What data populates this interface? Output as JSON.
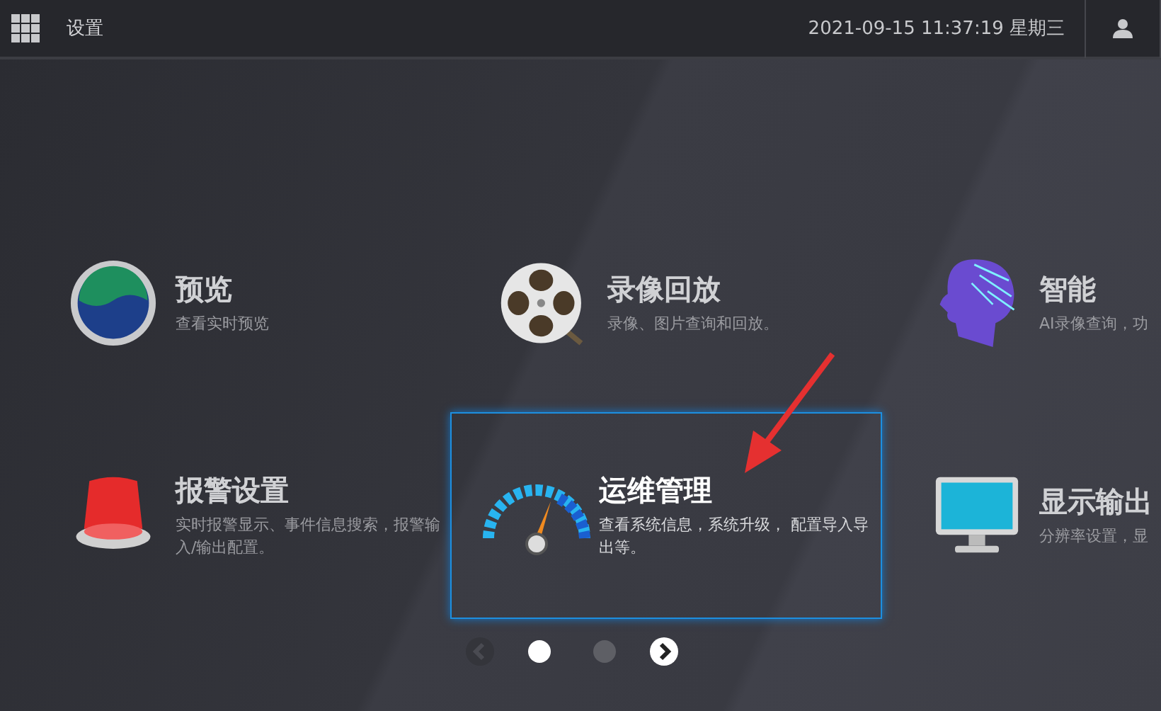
{
  "header": {
    "title": "设置",
    "datetime": "2021-09-15 11:37:19 星期三"
  },
  "tiles": [
    {
      "kind": "preview",
      "title": "预览",
      "description": "查看实时预览",
      "selected": false
    },
    {
      "kind": "playback",
      "title": "录像回放",
      "description": "录像、图片查询和回放。",
      "selected": false
    },
    {
      "kind": "ai",
      "title": "智能",
      "description": "AI录像查询，功",
      "selected": false
    },
    {
      "kind": "alarm",
      "title": "报警设置",
      "description": "实时报警显示、事件信息搜索，报警输入/输出配置。",
      "selected": false
    },
    {
      "kind": "maintenance",
      "title": "运维管理",
      "description": "查看系统信息，系统升级， 配置导入导出等。",
      "selected": true
    },
    {
      "kind": "display",
      "title": "显示输出",
      "description": "分辨率设置，显",
      "selected": false
    }
  ],
  "pagination": {
    "prev_disabled": true,
    "pages": [
      {
        "selected": true
      },
      {
        "selected": false
      }
    ],
    "next_disabled": false
  }
}
